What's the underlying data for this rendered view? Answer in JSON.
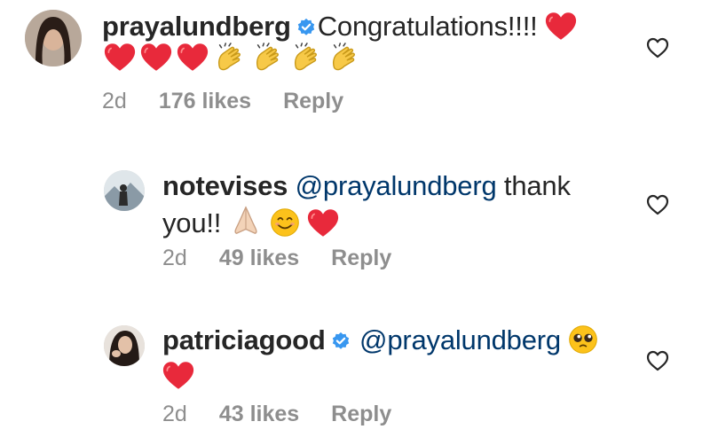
{
  "comments": [
    {
      "username": "prayalundberg",
      "verified": true,
      "text": "Congratulations!!!!",
      "time": "2d",
      "likes": "176 likes",
      "reply_label": "Reply"
    },
    {
      "username": "notevises",
      "verified": false,
      "mention": "@prayalundberg",
      "text": " thank",
      "text2": "you!!",
      "time": "2d",
      "likes": "49 likes",
      "reply_label": "Reply"
    },
    {
      "username": "patriciagood",
      "verified": true,
      "mention": "@prayalundberg",
      "time": "2d",
      "likes": "43 likes",
      "reply_label": "Reply"
    }
  ],
  "icons": {
    "like": "heart-outline-icon",
    "verified": "verified-badge-icon"
  },
  "colors": {
    "text": "#262626",
    "muted": "#8e8e8e",
    "mention": "#00376b",
    "verified": "#3897f0",
    "heart": "#e0245e"
  }
}
